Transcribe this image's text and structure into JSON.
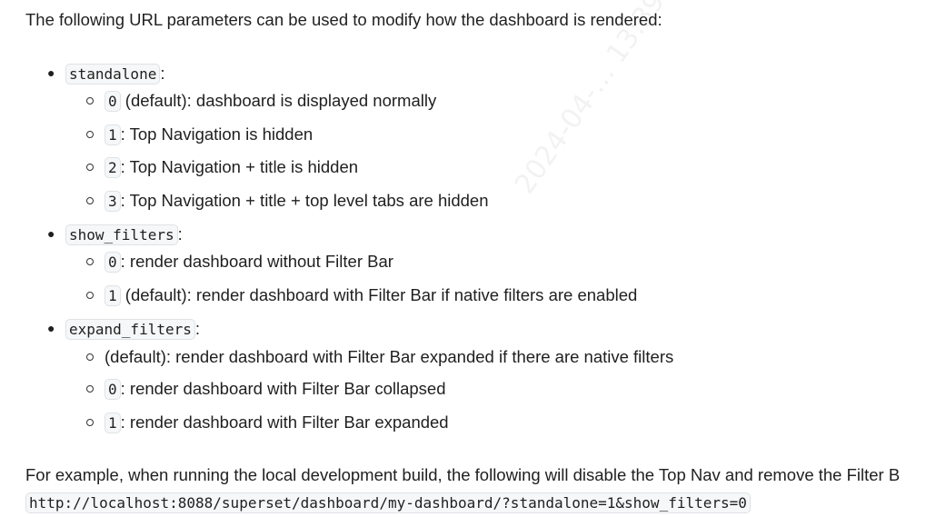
{
  "intro": "The following URL parameters can be used to modify how the dashboard is rendered:",
  "params": [
    {
      "name": "standalone",
      "options": [
        {
          "code": "0",
          "text": " (default): dashboard is displayed normally"
        },
        {
          "code": "1",
          "text": ": Top Navigation is hidden"
        },
        {
          "code": "2",
          "text": ": Top Navigation + title is hidden"
        },
        {
          "code": "3",
          "text": ": Top Navigation + title + top level tabs are hidden"
        }
      ]
    },
    {
      "name": "show_filters",
      "options": [
        {
          "code": "0",
          "text": ": render dashboard without Filter Bar"
        },
        {
          "code": "1",
          "text": " (default): render dashboard with Filter Bar if native filters are enabled"
        }
      ]
    },
    {
      "name": "expand_filters",
      "options": [
        {
          "code": "",
          "text": "(default): render dashboard with Filter Bar expanded if there are native filters"
        },
        {
          "code": "0",
          "text": ": render dashboard with Filter Bar collapsed"
        },
        {
          "code": "1",
          "text": ": render dashboard with Filter Bar expanded"
        }
      ]
    }
  ],
  "example_text": "For example, when running the local development build, the following will disable the Top Nav and remove the Filter B",
  "example_url": "http://localhost:8088/superset/dashboard/my-dashboard/?standalone=1&show_filters=0",
  "colon": ":"
}
